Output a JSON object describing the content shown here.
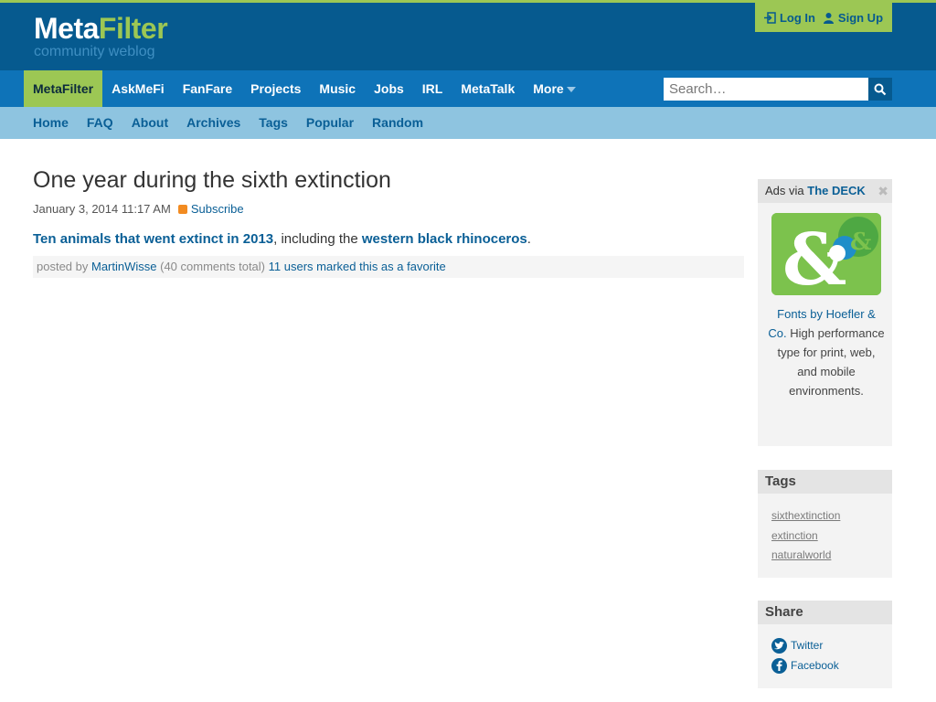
{
  "site": {
    "logo_meta": "Meta",
    "logo_filter": "Filter",
    "tagline": "community weblog"
  },
  "auth": {
    "login": "Log In",
    "signup": "Sign Up"
  },
  "main_nav": {
    "items": [
      "MetaFilter",
      "AskMeFi",
      "FanFare",
      "Projects",
      "Music",
      "Jobs",
      "IRL",
      "MetaTalk"
    ],
    "more": "More",
    "active": "MetaFilter"
  },
  "search": {
    "placeholder": "Search…"
  },
  "sub_nav": {
    "items": [
      "Home",
      "FAQ",
      "About",
      "Archives",
      "Tags",
      "Popular",
      "Random"
    ]
  },
  "post": {
    "title": "One year during the sixth extinction",
    "date": "January 3, 2014 11:17 AM",
    "subscribe": "Subscribe",
    "link1": "Ten animals that went extinct in 2013",
    "text_mid": ", including the ",
    "link2": "western black rhinoceros",
    "text_end": ".",
    "posted_by": "posted by ",
    "author": "MartinWisse",
    "comments": " (40 comments total) ",
    "favorites": "11 users marked this as a favorite"
  },
  "sidebar": {
    "ads": {
      "label": "Ads via ",
      "network": "The DECK",
      "close": "✖",
      "ad_link": "Fonts by Hoefler & Co.",
      "ad_text": " High performance type for print, web, and mobile environments."
    },
    "tags": {
      "heading": "Tags",
      "items": [
        "sixthextinction",
        "extinction",
        "naturalworld"
      ]
    },
    "share": {
      "heading": "Share",
      "items": [
        "Twitter",
        "Facebook"
      ]
    }
  },
  "colors": {
    "header_bg": "#065a8f",
    "nav_bg": "#0e73b8",
    "subnav_bg": "#8ec4e0",
    "accent_green": "#9cc754",
    "link": "#0a5f96"
  }
}
